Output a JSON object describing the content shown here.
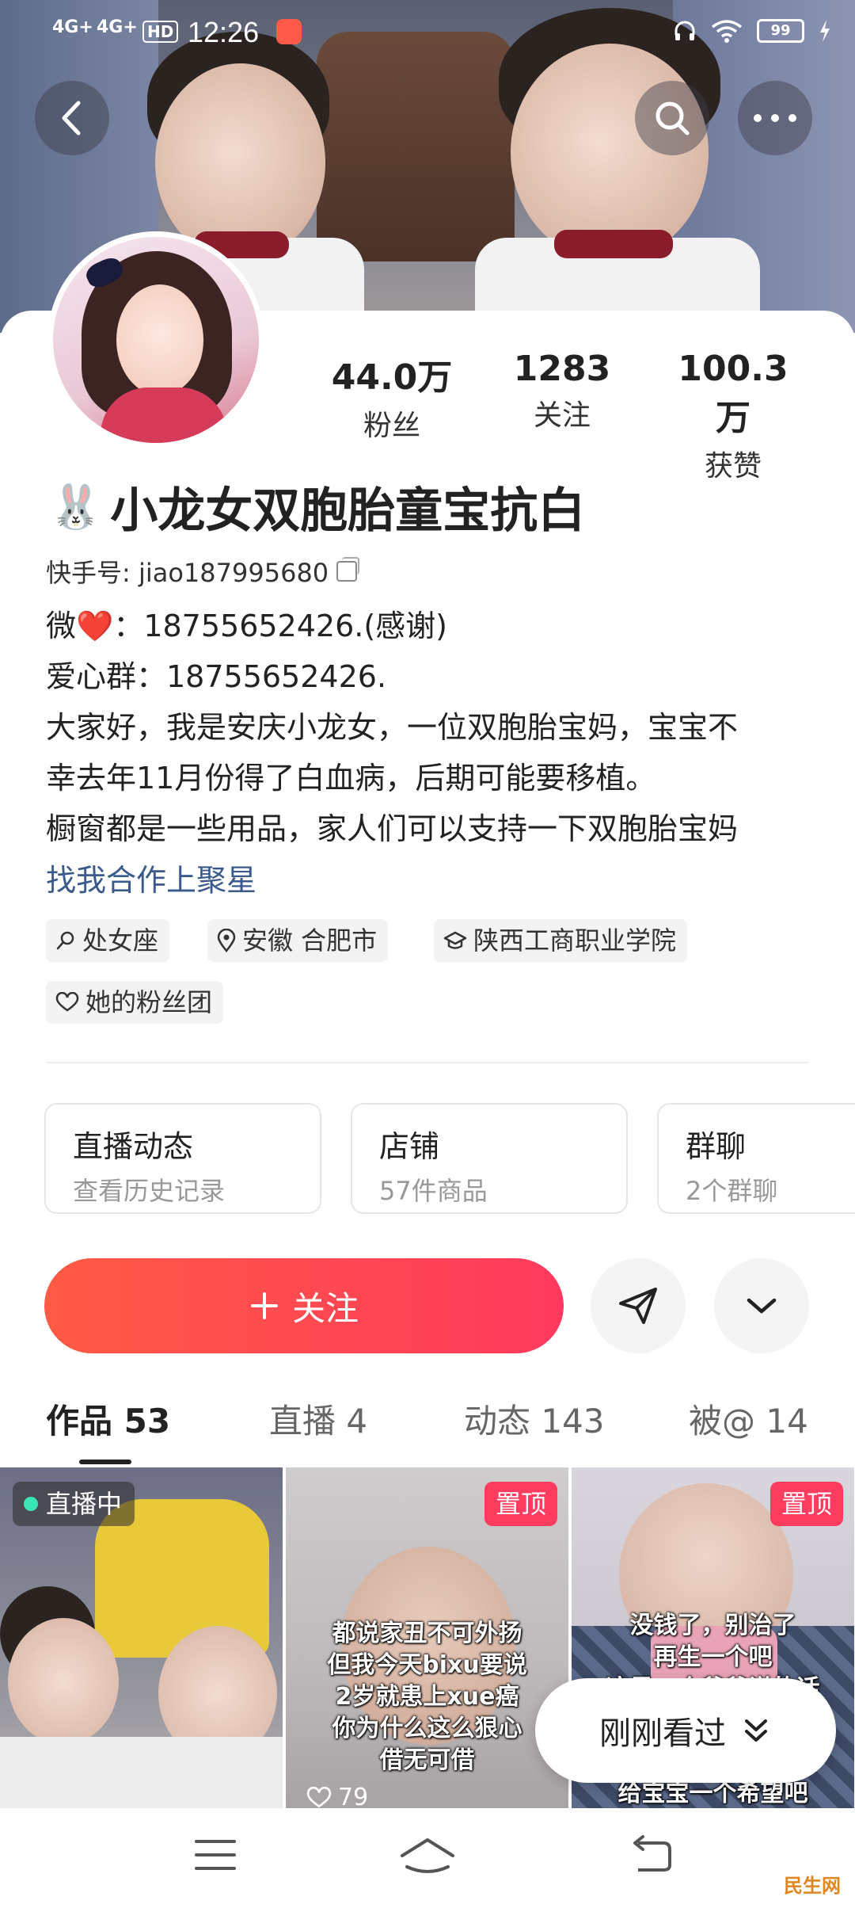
{
  "status_bar": {
    "network1": "4G+",
    "network2": "4G+",
    "hd": "HD",
    "time": "12:26",
    "battery": "99"
  },
  "profile": {
    "stats": [
      {
        "value": "44.0万",
        "label": "粉丝"
      },
      {
        "value": "1283",
        "label": "关注"
      },
      {
        "value": "100.3万",
        "label": "获赞"
      }
    ],
    "rabbit": "🐰",
    "nickname": "小龙女双胞胎童宝抗白",
    "kuaishou_id": "快手号: jiao187995680",
    "bio": [
      "微❤️：18755652426.(感谢)",
      "爱心群：18755652426.",
      "大家好，我是安庆小龙女，一位双胞胎宝妈，宝宝不",
      "幸去年11月份得了白血病，后期可能要移植。",
      "橱窗都是一些用品，家人们可以支持一下双胞胎宝妈"
    ],
    "cooperation_link": "找我合作上聚星",
    "tags": {
      "zodiac": "处女座",
      "location": "安徽 合肥市",
      "school": "陕西工商职业学院",
      "fan_group": "她的粉丝团"
    }
  },
  "features": [
    {
      "title": "直播动态",
      "sub": "查看历史记录"
    },
    {
      "title": "店铺",
      "sub": "57件商品"
    },
    {
      "title": "群聊",
      "sub": "2个群聊"
    }
  ],
  "actions": {
    "follow_label": "关注"
  },
  "tabs": [
    {
      "label": "作品 53"
    },
    {
      "label": "直播 4"
    },
    {
      "label": "动态 143"
    },
    {
      "label": "被@ 14"
    }
  ],
  "grid": {
    "live_badge": "直播中",
    "pin_badge": "置顶",
    "cell2_caption": [
      "都说家丑不可外扬",
      "但我今天bixu要说",
      "2岁就患上xue癌",
      "你为什么这么狠心",
      "借无可借"
    ],
    "cell2_likes": "79",
    "cell3_caption": [
      "没钱了，别治了",
      "再生一个吧",
      "这是一个爷爷说的话"
    ],
    "cell3_bottom": "给宝宝一个希望吧"
  },
  "recent_viewed": "刚刚看过",
  "watermark": "民生网",
  "colors": {
    "accent": "#ff3a5e",
    "pin_badge": "#fe3c5f",
    "link": "#3a5a8c",
    "live_dot": "#3ce6b4"
  }
}
